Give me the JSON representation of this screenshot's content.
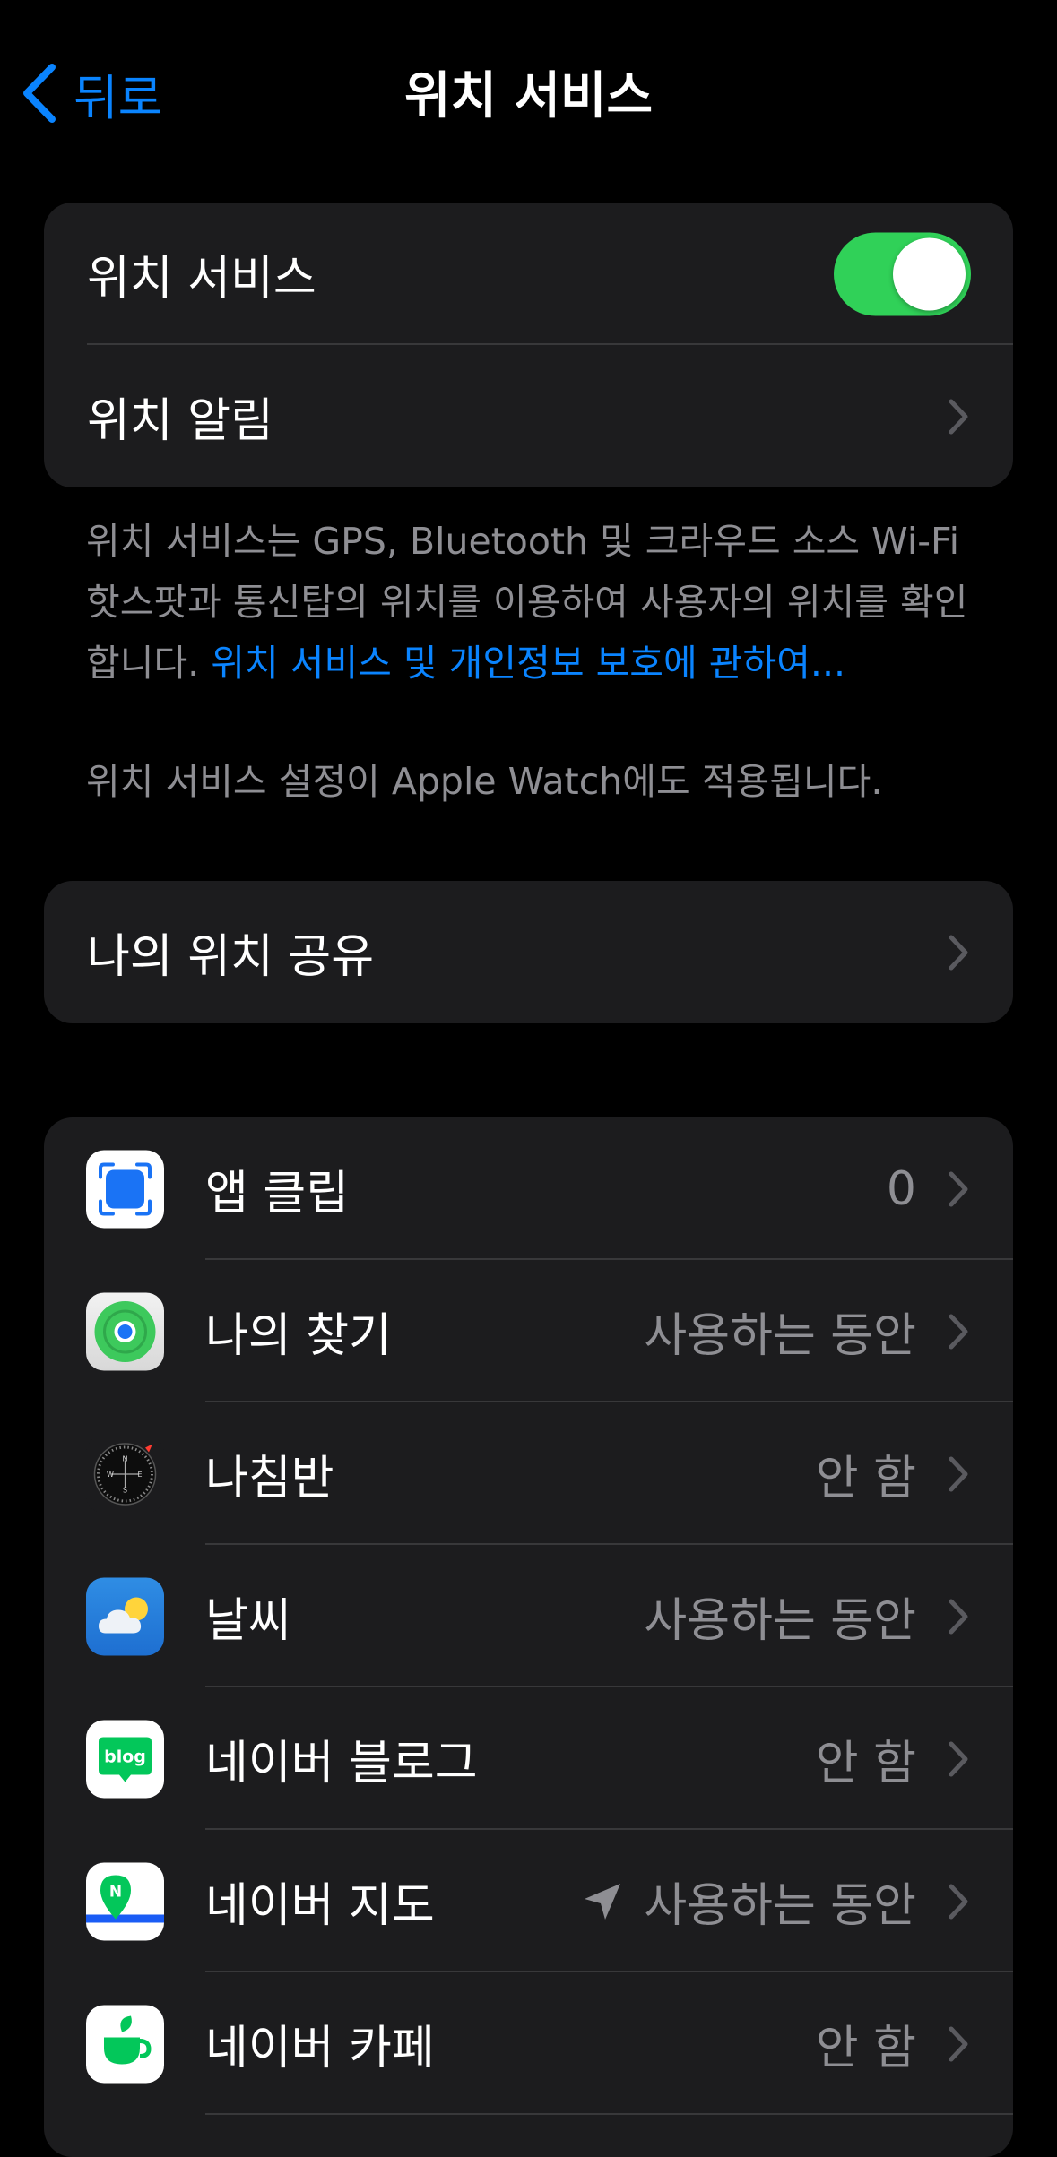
{
  "nav": {
    "back_label": "뒤로",
    "title": "위치 서비스"
  },
  "settings": {
    "location_services_label": "위치 서비스",
    "location_services_on": true,
    "location_alerts_label": "위치 알림"
  },
  "footnote": {
    "description": "위치 서비스는 GPS, Bluetooth 및 크라우드 소스 Wi-Fi 핫스팟과 통신탑의 위치를 이용하여 사용자의 위치를 확인합니다.",
    "link": "위치 서비스 및 개인정보 보호에 관하여...",
    "watch_note": "위치 서비스 설정이 Apple Watch에도 적용됩니다."
  },
  "share": {
    "label": "나의 위치 공유"
  },
  "apps": [
    {
      "name": "앱 클립",
      "value": "0",
      "icon": "app-clips-icon"
    },
    {
      "name": "나의 찾기",
      "value": "사용하는 동안",
      "icon": "find-my-icon"
    },
    {
      "name": "나침반",
      "value": "안 함",
      "icon": "compass-icon"
    },
    {
      "name": "날씨",
      "value": "사용하는 동안",
      "icon": "weather-icon"
    },
    {
      "name": "네이버 블로그",
      "value": "안 함",
      "icon": "naver-blog-icon",
      "icon_text": "blog"
    },
    {
      "name": "네이버 지도",
      "value": "사용하는 동안",
      "icon": "naver-map-icon",
      "icon_text": "N",
      "recent_use_arrow": true
    },
    {
      "name": "네이버 카페",
      "value": "안 함",
      "icon": "naver-cafe-icon"
    }
  ],
  "compass_letters": {
    "n": "N",
    "s": "S",
    "e": "E",
    "w": "W"
  },
  "colors": {
    "accent": "#0a84ff",
    "toggle_on": "#30d158",
    "cell_background": "#1c1c1e",
    "secondary_text": "#8e8e93",
    "background": "#000000"
  }
}
